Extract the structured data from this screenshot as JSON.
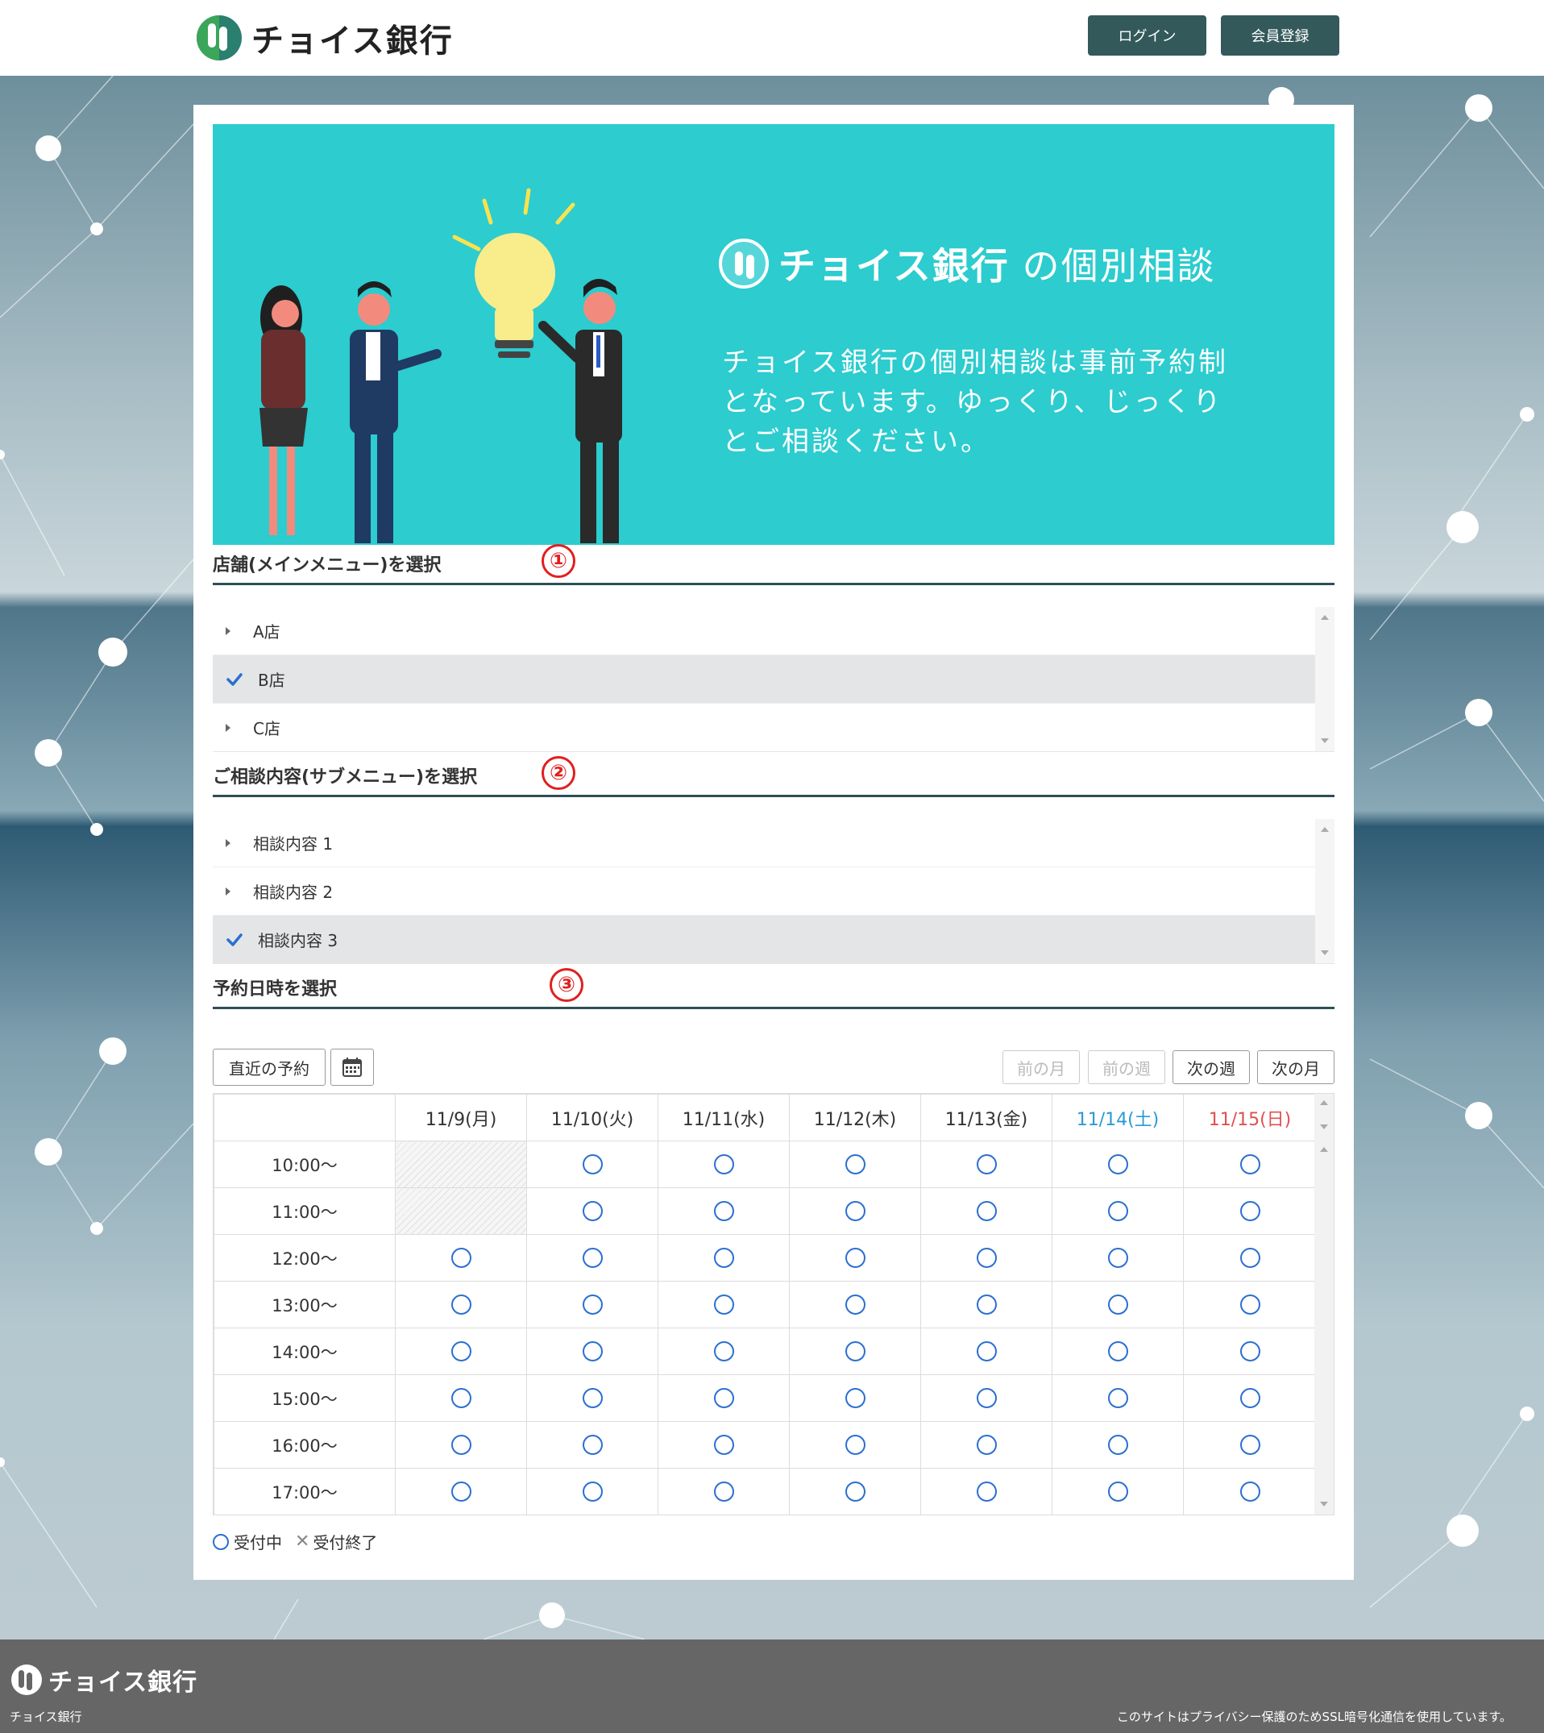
{
  "header": {
    "brand": "チョイス銀行",
    "login_label": "ログイン",
    "register_label": "会員登録"
  },
  "hero": {
    "brand": "チョイス銀行",
    "title_suffix": "の個別相談",
    "text": "チョイス銀行の個別相談は事前予約制となっています。ゆっくり、じっくりとご相談ください。"
  },
  "section1": {
    "title": "店舗(メインメニュー)を選択",
    "badge": "①",
    "items": [
      {
        "label": "A店",
        "selected": false
      },
      {
        "label": "B店",
        "selected": true
      },
      {
        "label": "C店",
        "selected": false
      }
    ]
  },
  "section2": {
    "title": "ご相談内容(サブメニュー)を選択",
    "badge": "②",
    "items": [
      {
        "label": "相談内容 1",
        "selected": false
      },
      {
        "label": "相談内容 2",
        "selected": false
      },
      {
        "label": "相談内容 3",
        "selected": true
      }
    ]
  },
  "section3": {
    "title": "予約日時を選択",
    "badge": "③",
    "recent_label": "直近の予約",
    "prev_month_label": "前の月",
    "prev_week_label": "前の週",
    "next_week_label": "次の週",
    "next_month_label": "次の月"
  },
  "schedule": {
    "days": [
      "11/9(月)",
      "11/10(火)",
      "11/11(水)",
      "11/12(木)",
      "11/13(金)",
      "11/14(土)",
      "11/15(日)"
    ],
    "times": [
      "10:00〜",
      "11:00〜",
      "12:00〜",
      "13:00〜",
      "14:00〜",
      "15:00〜",
      "16:00〜",
      "17:00〜"
    ],
    "closed_slots": [
      [
        0,
        0
      ],
      [
        1,
        0
      ]
    ]
  },
  "legend": {
    "open_label": "受付中",
    "closed_label": "受付終了"
  },
  "footer": {
    "brand": "チョイス銀行",
    "copyright": "チョイス銀行",
    "ssl_note": "このサイトはプライバシー保護のためSSL暗号化通信を使用しています。"
  },
  "colors": {
    "hero_bg": "#2ccccf",
    "header_button": "#33595b",
    "open_circle": "#2b6fd1",
    "saturday": "#2a9ad6",
    "sunday": "#e05050",
    "badge": "#e02020",
    "footer_bg": "#666666"
  }
}
